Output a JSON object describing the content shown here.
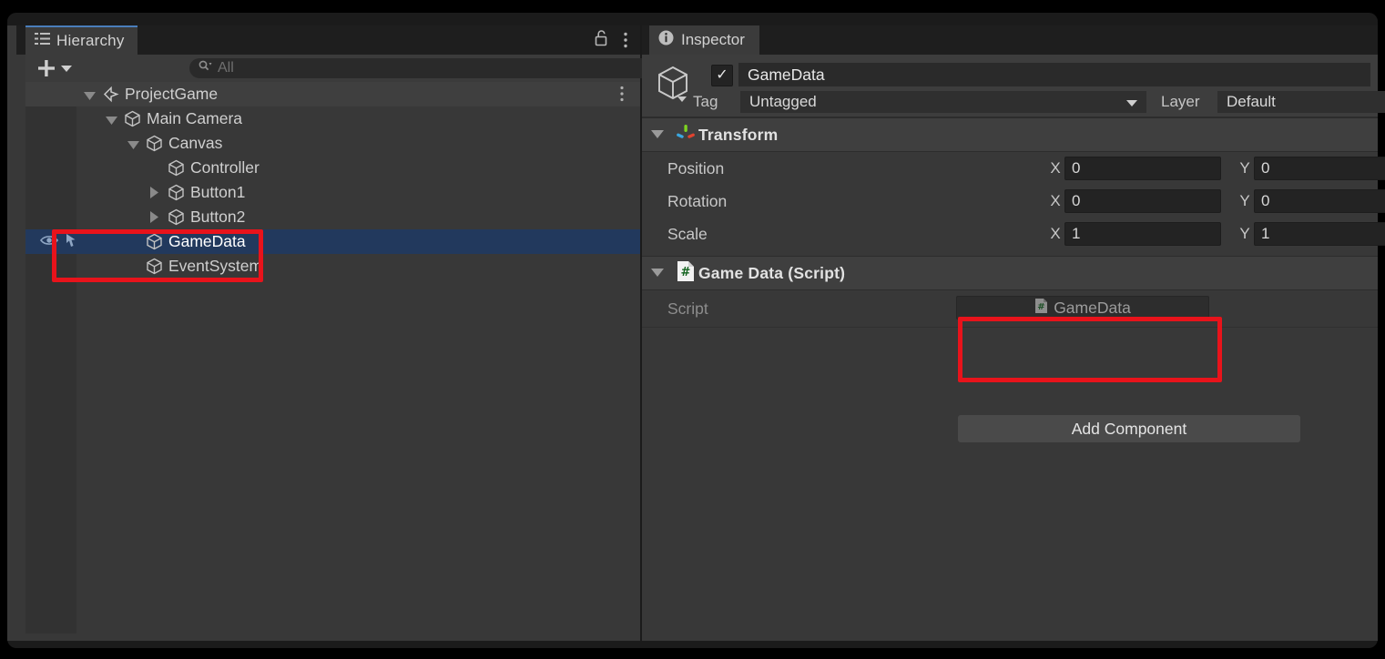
{
  "window": {
    "toolbar_ghost_buttons": 7
  },
  "hierarchy": {
    "tab_label": "Hierarchy",
    "tab_icon": "hierarchy-icon",
    "lock_icon": "unlocked-padlock-icon",
    "menu_icon": "kebab-menu-icon",
    "create_button_label": "+",
    "create_dropdown_icon": "chevron-down-icon",
    "search": {
      "icon": "search-icon",
      "placeholder": "All",
      "value": ""
    },
    "items": [
      {
        "label": "ProjectGame",
        "depth": 0,
        "icon": "unity-scene-icon",
        "expanded": true,
        "has_arrow": true,
        "selected": false,
        "is_root": true,
        "has_menu": true
      },
      {
        "label": "Main Camera",
        "depth": 1,
        "icon": "gameobject-cube-icon",
        "expanded": true,
        "has_arrow": true,
        "selected": false,
        "is_root": false,
        "has_menu": false
      },
      {
        "label": "Canvas",
        "depth": 2,
        "icon": "gameobject-cube-icon",
        "expanded": true,
        "has_arrow": true,
        "selected": false,
        "is_root": false,
        "has_menu": false
      },
      {
        "label": "Controller",
        "depth": 3,
        "icon": "gameobject-cube-icon",
        "expanded": false,
        "has_arrow": false,
        "selected": false,
        "is_root": false,
        "has_menu": false
      },
      {
        "label": "Button1",
        "depth": 3,
        "icon": "gameobject-cube-icon",
        "expanded": false,
        "has_arrow": true,
        "selected": false,
        "is_root": false,
        "has_menu": false
      },
      {
        "label": "Button2",
        "depth": 3,
        "icon": "gameobject-cube-icon",
        "expanded": false,
        "has_arrow": true,
        "selected": false,
        "is_root": false,
        "has_menu": false
      },
      {
        "label": "GameData",
        "depth": 2,
        "icon": "gameobject-cube-icon",
        "expanded": false,
        "has_arrow": false,
        "selected": true,
        "is_root": false,
        "has_menu": false
      },
      {
        "label": "EventSystem",
        "depth": 2,
        "icon": "gameobject-cube-icon",
        "expanded": false,
        "has_arrow": false,
        "selected": false,
        "is_root": false,
        "has_menu": false
      }
    ],
    "row_icons": {
      "visibility_icon": "eye-icon",
      "pickability_icon": "pointer-hand-icon"
    }
  },
  "inspector": {
    "tab_label": "Inspector",
    "tab_icon": "info-circle-icon",
    "object_icon": "gameobject-cube-icon",
    "object_dropdown_icon": "chevron-down-icon",
    "enabled": true,
    "enabled_checkmark": "✓",
    "name_value": "GameData",
    "tag_label": "Tag",
    "tag_value": "Untagged",
    "tag_dropdown_icon": "chevron-down-icon",
    "layer_label": "Layer",
    "layer_value": "Default",
    "components": [
      {
        "title": "Transform",
        "icon": "transform-axis-icon",
        "expanded": true,
        "collapse_icon": "triangle-down-icon",
        "rows": [
          {
            "label": "Position",
            "axes": [
              {
                "axis": "X",
                "value": "0"
              },
              {
                "axis": "Y",
                "value": "0"
              }
            ]
          },
          {
            "label": "Rotation",
            "axes": [
              {
                "axis": "X",
                "value": "0"
              },
              {
                "axis": "Y",
                "value": "0"
              }
            ]
          },
          {
            "label": "Scale",
            "axes": [
              {
                "axis": "X",
                "value": "1"
              },
              {
                "axis": "Y",
                "value": "1"
              }
            ]
          }
        ]
      },
      {
        "title": "Game Data (Script)",
        "icon": "csharp-script-icon",
        "expanded": true,
        "collapse_icon": "triangle-down-icon",
        "script_row": {
          "label": "Script",
          "value": "GameData",
          "value_icon": "csharp-script-icon"
        }
      }
    ],
    "add_component_label": "Add Component"
  },
  "annotations": {
    "color": "#e8131b",
    "boxes": [
      {
        "name": "hierarchy-gamedata-highlight",
        "target": "GameData"
      },
      {
        "name": "inspector-script-field-highlight",
        "target": "Script"
      }
    ]
  }
}
